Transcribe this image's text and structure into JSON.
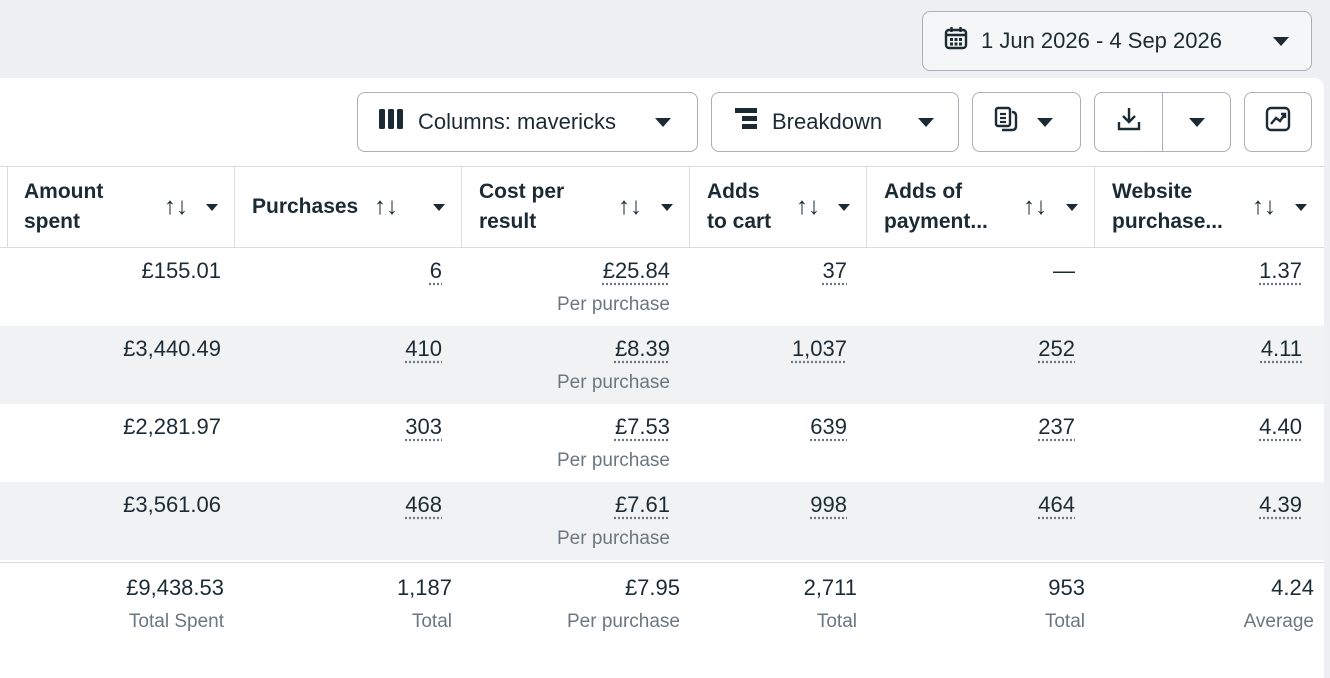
{
  "date_range": {
    "label": "1 Jun 2026 - 4 Sep 2026"
  },
  "toolbar": {
    "columns_label": "Columns: mavericks",
    "breakdown_label": "Breakdown"
  },
  "columns": [
    {
      "label": "Amount\nspent"
    },
    {
      "label": "Purchases"
    },
    {
      "label": "Cost per\nresult"
    },
    {
      "label": "Adds\nto cart"
    },
    {
      "label": "Adds of\npayment..."
    },
    {
      "label": "Website\npurchase..."
    }
  ],
  "rows": [
    {
      "amount": "£155.01",
      "purchases": "6",
      "cost": "£25.84",
      "cost_sub": "Per purchase",
      "adds_cart": "37",
      "adds_payment": "—",
      "website": "1.37"
    },
    {
      "amount": "£3,440.49",
      "purchases": "410",
      "cost": "£8.39",
      "cost_sub": "Per purchase",
      "adds_cart": "1,037",
      "adds_payment": "252",
      "website": "4.11"
    },
    {
      "amount": "£2,281.97",
      "purchases": "303",
      "cost": "£7.53",
      "cost_sub": "Per purchase",
      "adds_cart": "639",
      "adds_payment": "237",
      "website": "4.40"
    },
    {
      "amount": "£3,561.06",
      "purchases": "468",
      "cost": "£7.61",
      "cost_sub": "Per purchase",
      "adds_cart": "998",
      "adds_payment": "464",
      "website": "4.39"
    }
  ],
  "totals": {
    "amount": "£9,438.53",
    "amount_label": "Total Spent",
    "purchases": "1,187",
    "purchases_label": "Total",
    "cost": "£7.95",
    "cost_label": "Per purchase",
    "adds_cart": "2,711",
    "adds_cart_label": "Total",
    "adds_payment": "953",
    "adds_payment_label": "Total",
    "website": "4.24",
    "website_label": "Average"
  },
  "icons": {
    "date": "calendar-icon",
    "columns": "columns-icon",
    "breakdown": "breakdown-icon",
    "reports": "reports-icon",
    "export": "download-icon",
    "chart": "chart-icon"
  }
}
